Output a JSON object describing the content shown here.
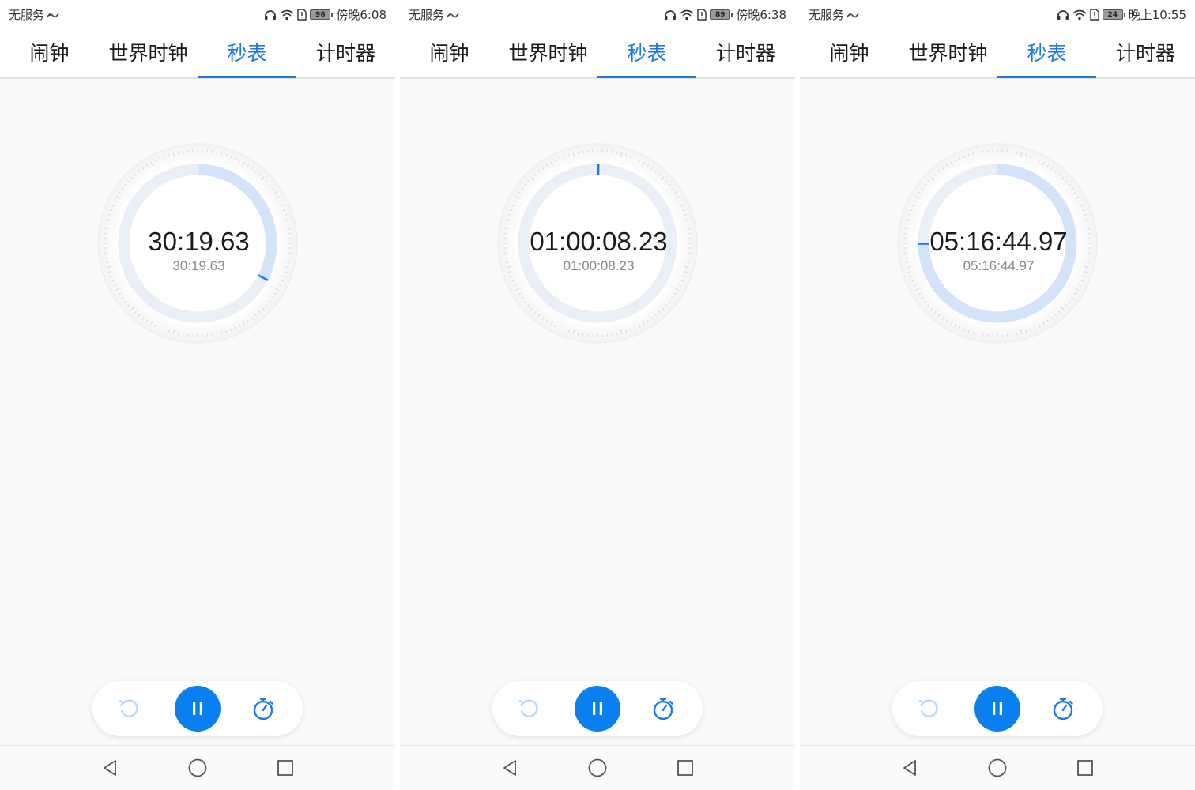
{
  "accent_color": "#1e7ae3",
  "pause_button_color": "#0a7ff0",
  "screens": [
    {
      "status": {
        "carrier": "无服务",
        "battery": "96",
        "time": "傍晚6:08"
      },
      "tabs": [
        "闹钟",
        "世界时钟",
        "秒表",
        "计时器"
      ],
      "active_tab": 2,
      "stopwatch": {
        "main": "30:19.63",
        "lap": "30:19.63",
        "progress": 0.327
      }
    },
    {
      "status": {
        "carrier": "无服务",
        "battery": "89",
        "time": "傍晚6:38"
      },
      "tabs": [
        "闹钟",
        "世界时钟",
        "秒表",
        "计时器"
      ],
      "active_tab": 2,
      "stopwatch": {
        "main": "01:00:08.23",
        "lap": "01:00:08.23",
        "progress": 0.002
      }
    },
    {
      "status": {
        "carrier": "无服务",
        "battery": "24",
        "time": "晚上10:55"
      },
      "tabs": [
        "闹钟",
        "世界时钟",
        "秒表",
        "计时器"
      ],
      "active_tab": 2,
      "stopwatch": {
        "main": "05:16:44.97",
        "lap": "05:16:44.97",
        "progress": 0.749
      }
    }
  ],
  "icons": {
    "status_left": "no-signal-icon",
    "status_right": [
      "headset-icon",
      "wifi-icon",
      "sim-icon",
      "battery-icon"
    ],
    "controls": [
      "reset-icon",
      "pause-icon",
      "lap-stopwatch-icon"
    ],
    "nav": [
      "back-icon",
      "home-icon",
      "recents-icon"
    ]
  }
}
